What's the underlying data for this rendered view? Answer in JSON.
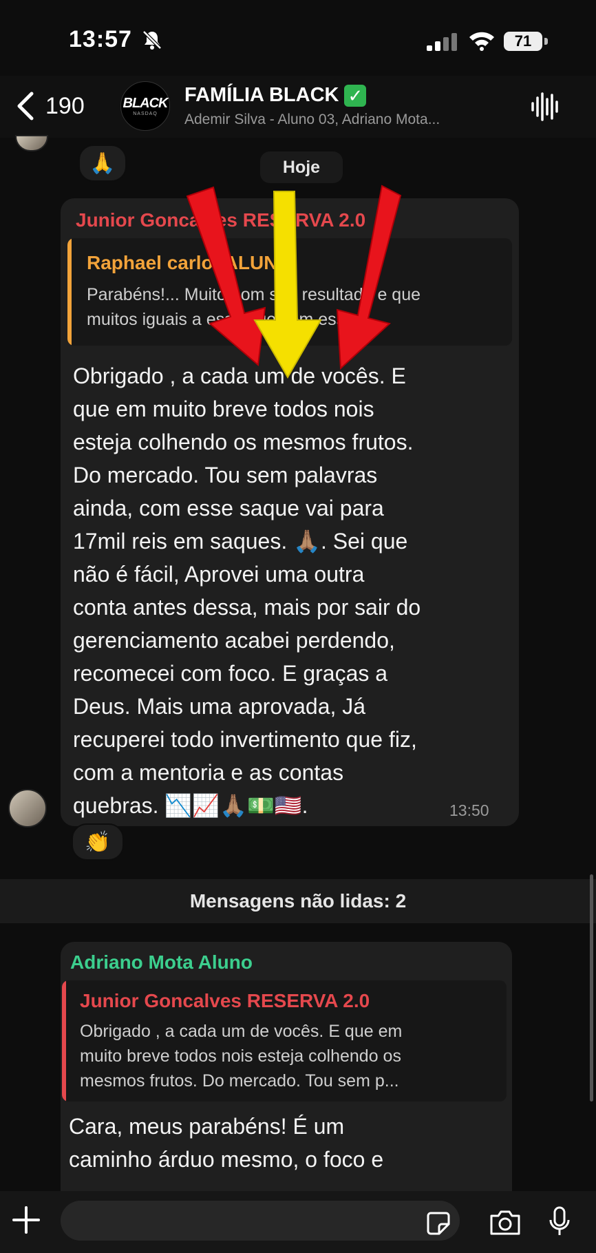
{
  "status_bar": {
    "time": "13:57",
    "battery": "71"
  },
  "header": {
    "back_count": "190",
    "avatar_brand": "BLACK",
    "avatar_sub": "NASDAQ",
    "title": "FAMÍLIA BLACK",
    "verified_mark": "✓",
    "subtitle": "Ademir Silva - Aluno 03, Adriano Mota..."
  },
  "day_separator": "Hoje",
  "reactions": {
    "prev_message": "🙏",
    "message1": "👏"
  },
  "message1": {
    "sender": "Junior Goncalves RESERVA 2.0",
    "sender_color": "#e5484d",
    "quote": {
      "name": "Raphael carlot ALUNO",
      "name_color": "#f2a33a",
      "text_line1": "Parabéns!... Muito bom seu resultado e que",
      "text_line2": "muitos iguais a esse que vem esse."
    },
    "lines": [
      "Obrigado , a cada um de vocês.  E",
      "que em muito breve todos nois",
      "esteja colhendo os mesmos frutos.",
      "Do mercado.   Tou sem palavras",
      "ainda, com esse saque vai para",
      "17mil reis em saques. 🙏🏽.   Sei que",
      "não é fácil,   Aprovei uma outra",
      "conta antes dessa, mais por sair do",
      "gerenciamento acabei perdendo,",
      "recomecei com foco. E graças a",
      "Deus. Mais uma aprovada,   Já",
      "recuperei todo invertimento que fiz,",
      "com a mentoria e as contas",
      "quebras. 📉📈🙏🏽💵🇺🇸."
    ],
    "time": "13:50"
  },
  "unread_label": "Mensagens não lidas: 2",
  "message2": {
    "sender": "Adriano Mota Aluno",
    "sender_color": "#3ccf8e",
    "quote": {
      "name": "Junior Goncalves RESERVA 2.0",
      "name_color": "#e5484d",
      "text_line1": "Obrigado , a cada um de vocês.  E que em",
      "text_line2": "muito breve todos nois esteja colhendo os",
      "text_line3": "mesmos frutos.  Do mercado.   Tou sem p..."
    },
    "lines": [
      "Cara, meus parabéns! É um",
      "caminho árduo mesmo, o foco e"
    ]
  },
  "input": {
    "placeholder": ""
  },
  "colors": {
    "arrow_red": "#e8141c",
    "arrow_yellow": "#f5e000",
    "bubble": "#1f1f1f"
  }
}
